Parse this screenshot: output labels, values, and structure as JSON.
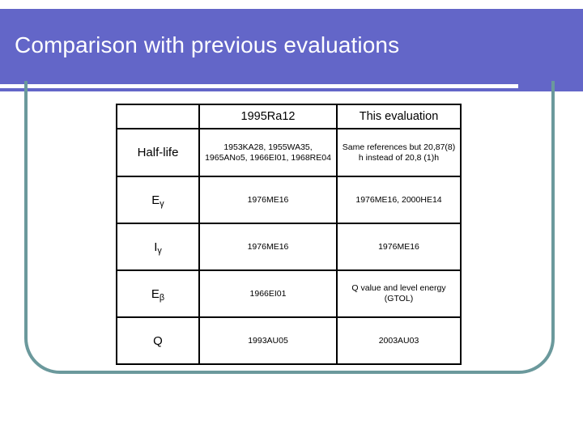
{
  "slide": {
    "title": "Comparison with previous evaluations",
    "accent_color": "#6366c8",
    "frame_color": "#6b999c",
    "background_color": "#ffffff",
    "title_color": "#ffffff"
  },
  "table": {
    "columns": [
      {
        "key": "label",
        "header": ""
      },
      {
        "key": "previous",
        "header": "1995Ra12"
      },
      {
        "key": "current",
        "header": "This evaluation"
      }
    ],
    "rows": [
      {
        "label": "Half-life",
        "label_base": "Half-life",
        "label_sub": "",
        "previous": "1953KA28, 1955WA35, 1965ANo5, 1966EI01, 1968RE04",
        "current": "Same references but 20,87(8) h instead of 20,8 (1)h"
      },
      {
        "label": "Eγ",
        "label_base": "E",
        "label_sub": "γ",
        "previous": "1976ME16",
        "current": "1976ME16, 2000HE14"
      },
      {
        "label": "Iγ",
        "label_base": "I",
        "label_sub": "γ",
        "previous": "1976ME16",
        "current": "1976ME16"
      },
      {
        "label": "Eβ",
        "label_base": "E",
        "label_sub": "β",
        "previous": "1966EI01",
        "current": "Q value and level energy (GTOL)"
      },
      {
        "label": "Q",
        "label_base": "Q",
        "label_sub": "",
        "previous": "1993AU05",
        "current": "2003AU03"
      }
    ]
  }
}
